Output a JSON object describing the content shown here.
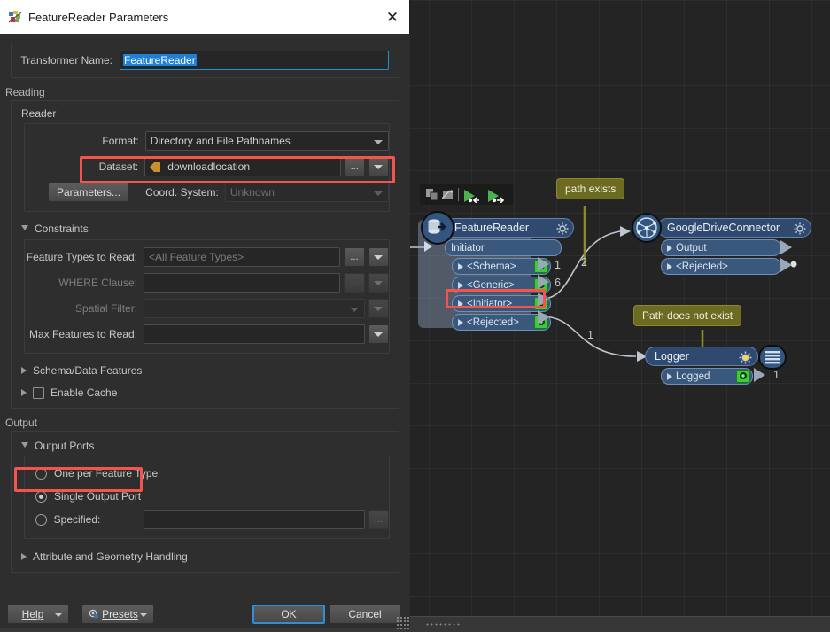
{
  "dialog": {
    "title": "FeatureReader Parameters",
    "title_icon": "fme-workbench-icon",
    "close_icon": "close-icon",
    "transformer_name_label": "Transformer Name:",
    "transformer_name_value": "FeatureReader",
    "sections": {
      "reading_title": "Reading",
      "reader_group_label": "Reader",
      "format_label": "Format:",
      "format_value": "Directory and File Pathnames",
      "dataset_label": "Dataset:",
      "dataset_value": "downloadlocation",
      "dataset_icon": "user-parameter-icon",
      "browse_label": "...",
      "parameters_button": "Parameters...",
      "coord_system_label": "Coord. System:",
      "coord_system_value": "Unknown",
      "constraints_label": "Constraints",
      "feature_types_label": "Feature Types to Read:",
      "feature_types_value": "<All Feature Types>",
      "where_clause_label": "WHERE Clause:",
      "where_clause_value": "",
      "spatial_filter_label": "Spatial Filter:",
      "spatial_filter_value": "",
      "max_features_label": "Max Features to Read:",
      "max_features_value": "",
      "schema_data_features_label": "Schema/Data Features",
      "enable_cache_label": "Enable Cache",
      "output_title": "Output",
      "output_ports_label": "Output Ports",
      "radio_one_per_feature_type": "One per Feature Type",
      "radio_single_output_port": "Single Output Port",
      "radio_specified": "Specified:",
      "specified_value": "",
      "attribute_geometry_label": "Attribute and Geometry Handling"
    },
    "footer": {
      "help_label": "Help",
      "presets_label": "Presets",
      "presets_icon": "presets-gear-icon",
      "ok_label": "OK",
      "cancel_label": "Cancel"
    },
    "highlights": [
      "dataset-row-highlight",
      "initiator-port-highlight",
      "single-output-port-highlight"
    ]
  },
  "canvas": {
    "toolbar_icons": [
      "duplicate-icon",
      "edit-icon",
      "separator",
      "run-to-here-icon",
      "run-from-here-icon"
    ],
    "nodes": [
      {
        "id": "featurereader",
        "title": "FeatureReader",
        "icon": "reader-database-icon",
        "gear_icon": "gear-icon",
        "input_port": "Initiator",
        "output_ports": [
          {
            "label": "<Schema>",
            "count": "1"
          },
          {
            "label": "<Generic>",
            "count": "6"
          },
          {
            "label": "<Initiator>",
            "count": "2"
          },
          {
            "label": "<Rejected>",
            "count": "1"
          }
        ]
      },
      {
        "id": "googledriveconnector",
        "title": "GoogleDriveConnector",
        "icon": "network-globe-icon",
        "gear_icon": "gear-icon",
        "output_ports": [
          {
            "label": "Output",
            "count": ""
          },
          {
            "label": "<Rejected>",
            "count": ""
          }
        ]
      },
      {
        "id": "logger",
        "title": "Logger",
        "icon": "log-lines-icon",
        "gear_icon": "gear-icon-active",
        "output_ports": [
          {
            "label": "Logged",
            "count": "1"
          }
        ]
      }
    ],
    "annotations": [
      {
        "id": "path-exists",
        "text": "path exists"
      },
      {
        "id": "path-does-not-exist",
        "text": "Path does not exist"
      }
    ]
  },
  "colors": {
    "accent_blue": "#1e90d8",
    "highlight_red": "#f4534e",
    "node_header": "#2f4a6e",
    "node_port": "#3a577c",
    "callout": "#6d6b22",
    "port_badge_green": "#3ec93e",
    "canvas_bg": "#242424"
  }
}
